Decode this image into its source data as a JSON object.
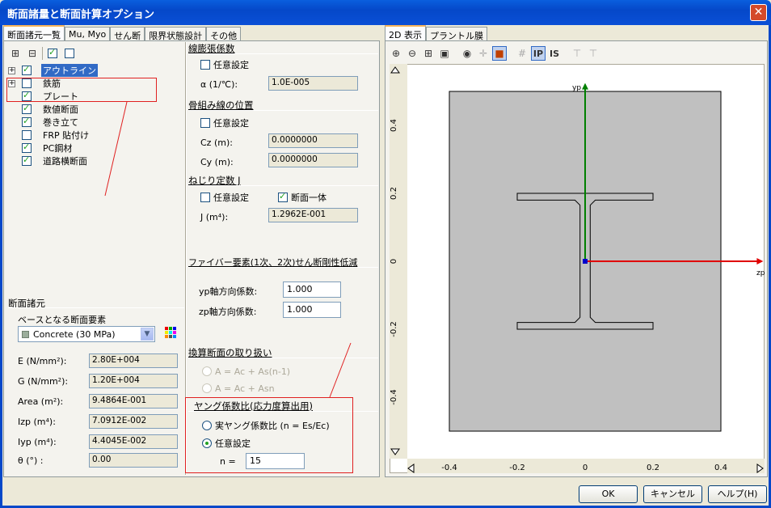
{
  "window": {
    "title": "断面諸量と断面計算オプション"
  },
  "left_tabs": [
    "断面諸元一覧",
    "Mu, Myo",
    "せん断",
    "限界状態設計",
    "その他"
  ],
  "tree": [
    {
      "label": "アウトライン",
      "checked": true,
      "expandable": true,
      "selected": true
    },
    {
      "label": "鉄筋",
      "checked": false,
      "expandable": true
    },
    {
      "label": "プレート",
      "checked": true,
      "expandable": false
    },
    {
      "label": "数値断面",
      "checked": true,
      "expandable": false
    },
    {
      "label": "巻き立て",
      "checked": true,
      "expandable": false
    },
    {
      "label": "FRP 貼付け",
      "checked": false,
      "expandable": false
    },
    {
      "label": "PC鋼材",
      "checked": true,
      "expandable": false
    },
    {
      "label": "道路横断面",
      "checked": true,
      "expandable": false
    }
  ],
  "properties": {
    "header": "断面諸元",
    "base_label": "ベースとなる断面要素",
    "base_value": "Concrete (30 MPa)",
    "rows": [
      {
        "label": "E (N/mm²):",
        "value": "2.80E+004"
      },
      {
        "label": "G (N/mm²):",
        "value": "1.20E+004"
      },
      {
        "label": "Area (m²):",
        "value": "9.4864E-001"
      },
      {
        "label": "Izp (m⁴):",
        "value": "7.0912E-002"
      },
      {
        "label": "Iyp (m⁴):",
        "value": "4.4045E-002"
      },
      {
        "label": "θ (°) :",
        "value": "0.00"
      }
    ]
  },
  "thermal": {
    "header": "線膨張係数",
    "custom": "任意設定",
    "alpha_label": "α (1/℃):",
    "alpha_value": "1.0E-005"
  },
  "centroid": {
    "header": "骨組み線の位置",
    "custom": "任意設定",
    "cz_label": "Cz (m):",
    "cz_value": "0.0000000",
    "cy_label": "Cy (m):",
    "cy_value": "0.0000000"
  },
  "torsion": {
    "header": "ねじり定数 J",
    "custom": "任意設定",
    "integral": "断面一体",
    "j_label": "J (m⁴):",
    "j_value": "1.2962E-001"
  },
  "fiber": {
    "header": "ファイバー要素(1次、2次)せん断剛性低減",
    "yp_label": "yp軸方向係数:",
    "yp_value": "1.000",
    "zp_label": "zp軸方向係数:",
    "zp_value": "1.000"
  },
  "transformed": {
    "header": "換算断面の取り扱い",
    "opt1": "A = Ac + As(n-1)",
    "opt2": "A = Ac + Asn"
  },
  "young": {
    "header": "ヤング係数比(応力度算出用)",
    "opt1": "実ヤング係数比 (n = Es/Ec)",
    "opt2": "任意設定",
    "n_label": "n =",
    "n_value": "15"
  },
  "right_tabs": [
    "2D 表示",
    "プラントル膜"
  ],
  "chart_data": {
    "type": "diagram",
    "y_ticks": [
      "0.4",
      "0.2",
      "0",
      "-0.2",
      "-0.4"
    ],
    "x_ticks": [
      "-0.4",
      "-0.2",
      "0",
      "0.2",
      "0.4"
    ],
    "axis_y_label": "yp",
    "axis_z_label": "zp"
  },
  "buttons": {
    "ok": "OK",
    "cancel": "キャンセル",
    "help": "ヘルプ(H)"
  }
}
